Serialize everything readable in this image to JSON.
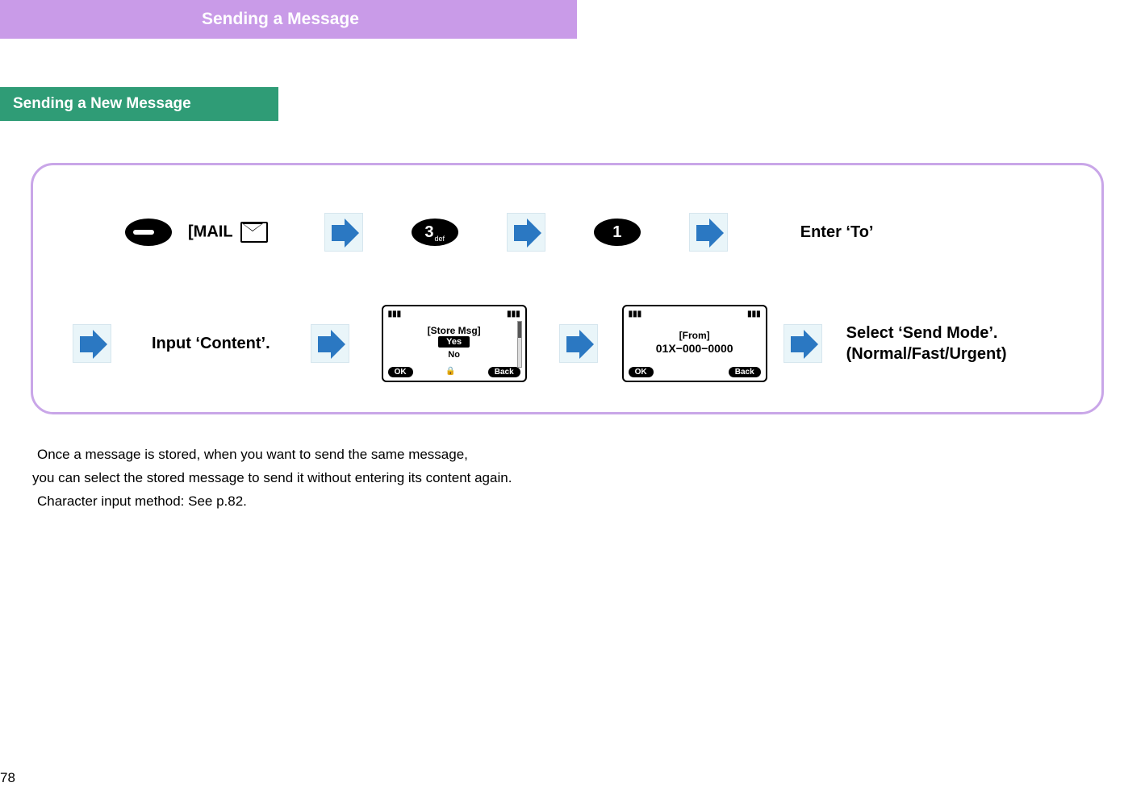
{
  "title": "Sending a Message",
  "subtitle": "Sending a New Message",
  "row1": {
    "mail_label": "[MAIL",
    "key3": "3",
    "key3_sub": "def",
    "key1": "1",
    "enter_to": "Enter ‘To’"
  },
  "row2": {
    "input_content": "Input ‘Content’.",
    "select_mode_line1": "Select ‘Send Mode’.",
    "select_mode_line2": "(Normal/Fast/Urgent)"
  },
  "screen_store": {
    "header": "[Store Msg]",
    "yes": "Yes",
    "no": "No",
    "ok": "OK",
    "back": "Back"
  },
  "screen_from": {
    "header": "[From]",
    "number": "01X−000−0000",
    "ok": "OK",
    "back": "Back"
  },
  "notes": {
    "line1": " Once a message is stored, when you want to send the same message,",
    "line2": "you can select the stored message to send it without entering its content again.",
    "line3": " Character input method: See p.82."
  },
  "page_number": "78"
}
